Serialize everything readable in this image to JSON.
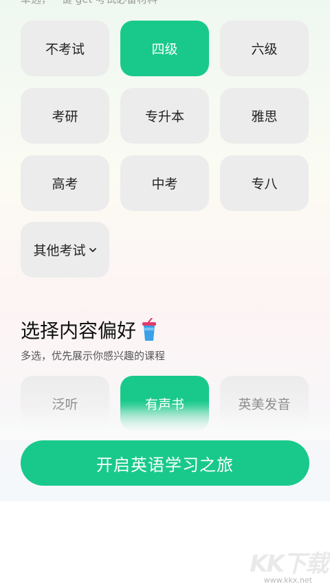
{
  "header_hint": "单选，一键 get 考试必备材料",
  "exams": [
    {
      "label": "不考试",
      "selected": false
    },
    {
      "label": "四级",
      "selected": true
    },
    {
      "label": "六级",
      "selected": false
    },
    {
      "label": "考研",
      "selected": false
    },
    {
      "label": "专升本",
      "selected": false
    },
    {
      "label": "雅思",
      "selected": false
    },
    {
      "label": "高考",
      "selected": false
    },
    {
      "label": "中考",
      "selected": false
    },
    {
      "label": "专八",
      "selected": false
    },
    {
      "label": "其他考试",
      "selected": false,
      "icon": "chevron-down-icon"
    }
  ],
  "preference": {
    "title": "选择内容偏好",
    "title_icon": "drink-cup-icon",
    "subtitle": "多选，优先展示你感兴趣的课程",
    "options": [
      {
        "label": "泛听",
        "selected": false
      },
      {
        "label": "有声书",
        "selected": true
      },
      {
        "label": "英美发音",
        "selected": false
      }
    ]
  },
  "cta": {
    "label": "开启英语学习之旅"
  },
  "watermark": {
    "logo": "KK下载",
    "url": "www.kkx.net"
  },
  "colors": {
    "accent": "#19c98b",
    "tile": "#ececec"
  }
}
